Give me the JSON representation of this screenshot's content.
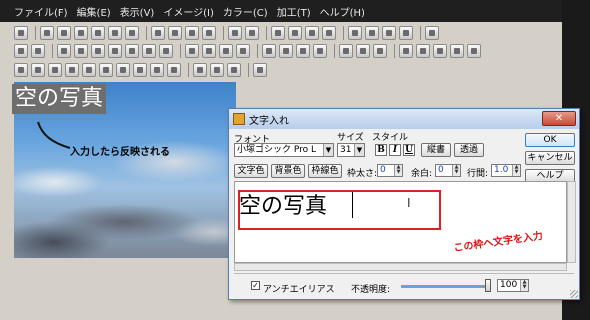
{
  "menu": [
    "ファイル(F)",
    "編集(E)",
    "表示(V)",
    "イメージ(I)",
    "カラー(C)",
    "加工(T)",
    "ヘルプ(H)"
  ],
  "canvas": {
    "title_text": "空の写真",
    "annotation_reflect": "入力したら反映される"
  },
  "dialog": {
    "title": "文字入れ",
    "close_glyph": "✕",
    "font_label": "フォント",
    "font_value": "小塚ゴシック Pro L",
    "size_label": "サイズ",
    "size_value": "31",
    "style_label": "スタイル",
    "style_bold": "B",
    "style_italic": "I",
    "style_underline": "U",
    "vertical_button": "縦書",
    "transparent_button": "透過",
    "ok_button": "OK",
    "cancel_button": "キャンセル",
    "help_button": "ヘルプ",
    "text_color_button": "文字色",
    "bg_color_button": "背景色",
    "border_color_button": "枠線色",
    "border_width_label": "枠太さ:",
    "border_width_value": "0",
    "margin_label": "余白:",
    "margin_value": "0",
    "line_spacing_label": "行間:",
    "line_spacing_value": "1.0",
    "text_value": "空の写真",
    "annotation_input": "この枠へ文字を入力",
    "antialias_label": "アンチエイリアス",
    "antialias_checked": true,
    "opacity_label": "不透明度:",
    "opacity_value": "100",
    "opacity_fraction": 1.0
  }
}
